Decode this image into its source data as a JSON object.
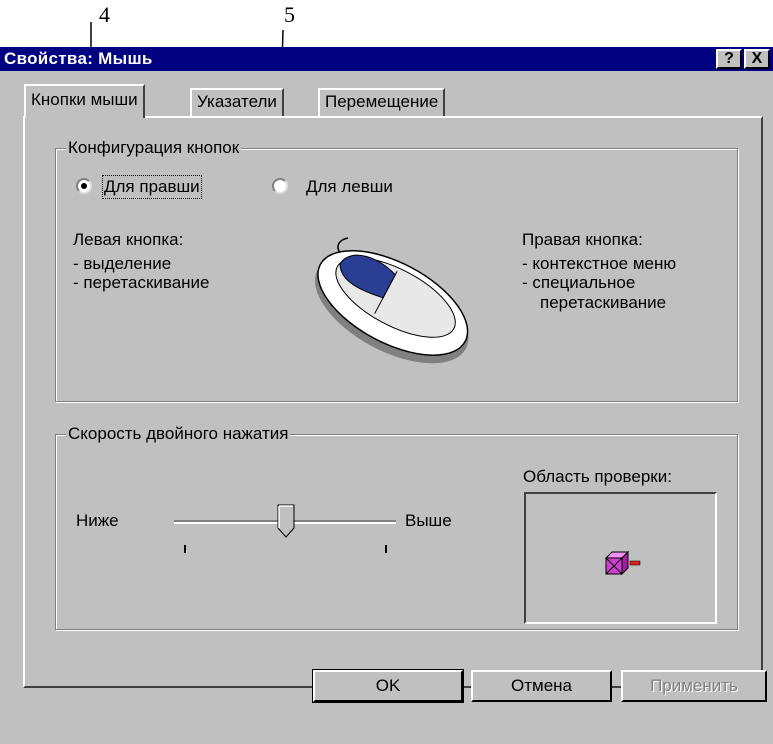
{
  "callouts": {
    "label_4": "4",
    "label_5": "5"
  },
  "window": {
    "title": "Свойства: Мышь",
    "help_button": "?",
    "close_button": "X"
  },
  "tabs": [
    {
      "label": "Кнопки мыши",
      "active": true
    },
    {
      "label": "Указатели",
      "active": false
    },
    {
      "label": "Перемещение",
      "active": false
    }
  ],
  "buttons_config": {
    "group_label": "Конфигурация кнопок",
    "right_handed_label": "Для правши",
    "left_handed_label": "Для левши",
    "selected": "right_handed",
    "left_button_title": "Левая кнопка:",
    "left_button_actions": [
      "- выделение",
      "- перетаскивание"
    ],
    "right_button_title": "Правая кнопка:",
    "right_button_actions": [
      "- контекстное меню",
      "- специальное",
      "перетаскивание"
    ]
  },
  "double_click": {
    "group_label": "Скорость двойного нажатия",
    "slower_label": "Ниже",
    "faster_label": "Выше",
    "speed_level": 0.5,
    "test_area_label": "Область проверки:"
  },
  "dialog_buttons": {
    "ok": "OK",
    "cancel": "Отмена",
    "apply": "Применить"
  },
  "colors": {
    "title_bar": "#000080",
    "face": "#c0c0c0",
    "mouse_button": "#2a3f94",
    "test_icon": "#d040d0"
  }
}
